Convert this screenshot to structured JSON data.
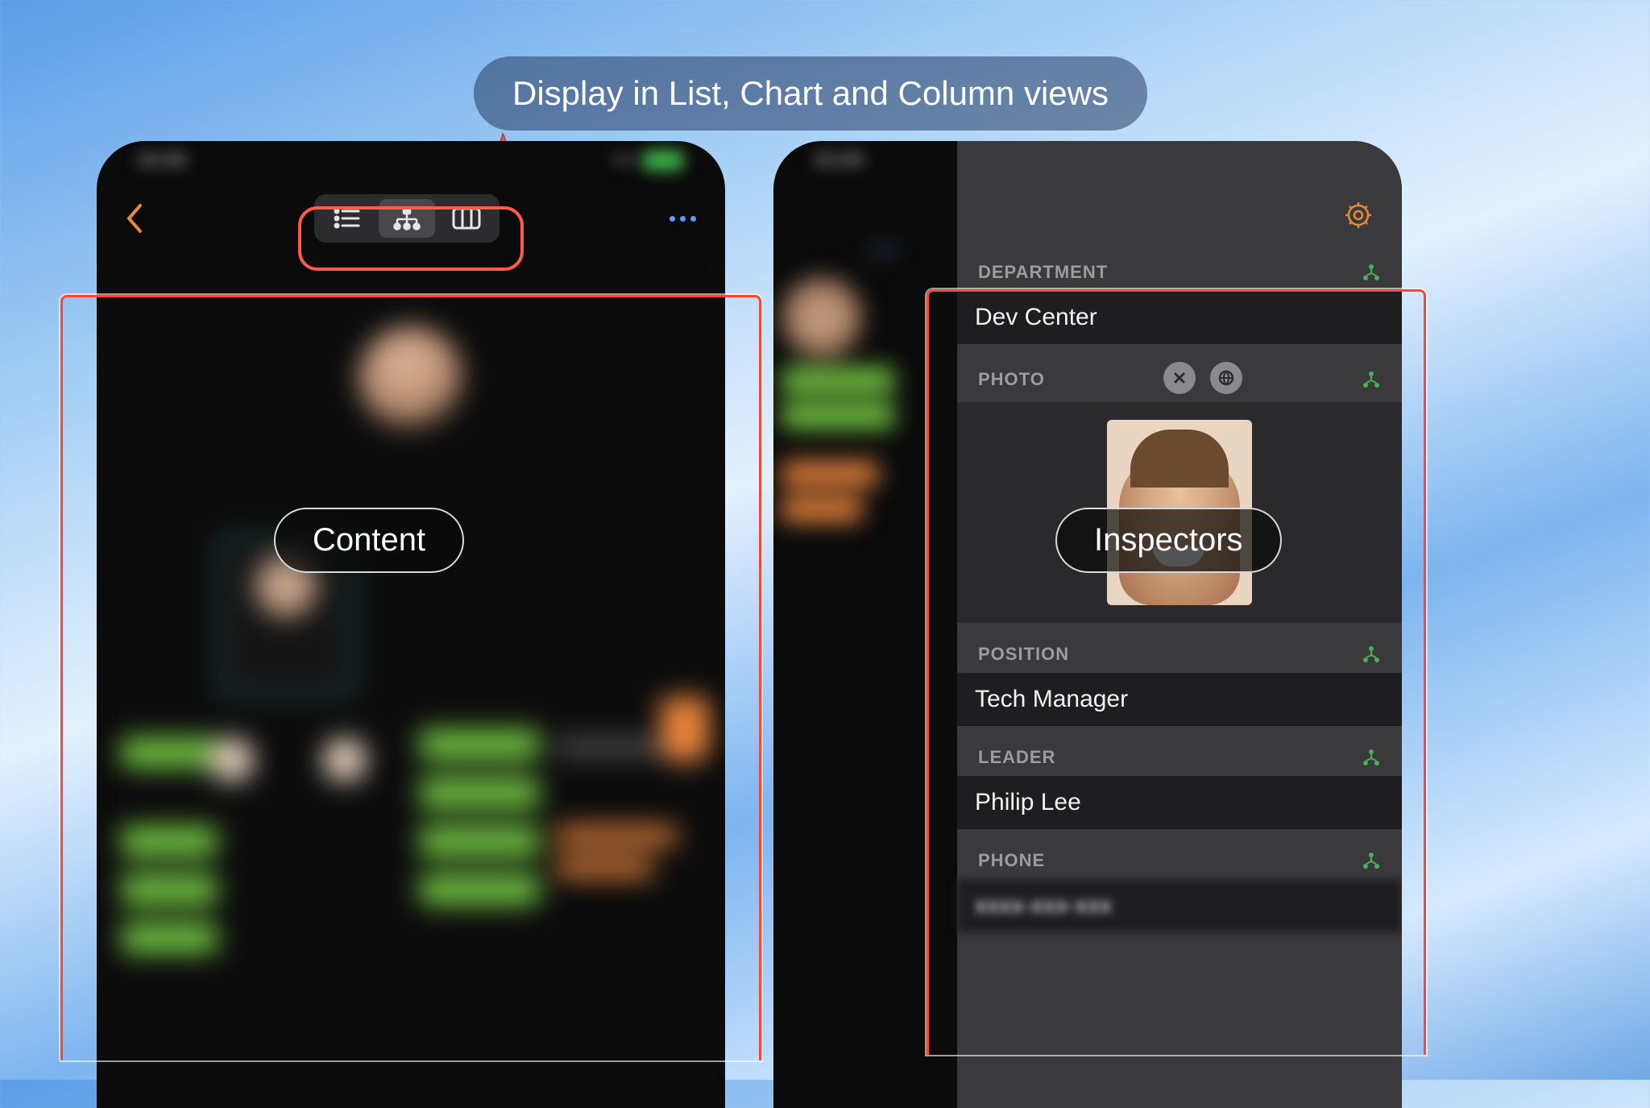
{
  "callout": "Display in List, Chart and Column views",
  "labels": {
    "content": "Content",
    "inspectors": "Inspectors"
  },
  "inspector": {
    "department_label": "DEPARTMENT",
    "department_value": "Dev Center",
    "photo_label": "PHOTO",
    "position_label": "POSITION",
    "position_value": "Tech Manager",
    "leader_label": "LEADER",
    "leader_value": "Philip Lee",
    "phone_label": "PHONE",
    "phone_value": "xxxx-xxx-xxx"
  }
}
